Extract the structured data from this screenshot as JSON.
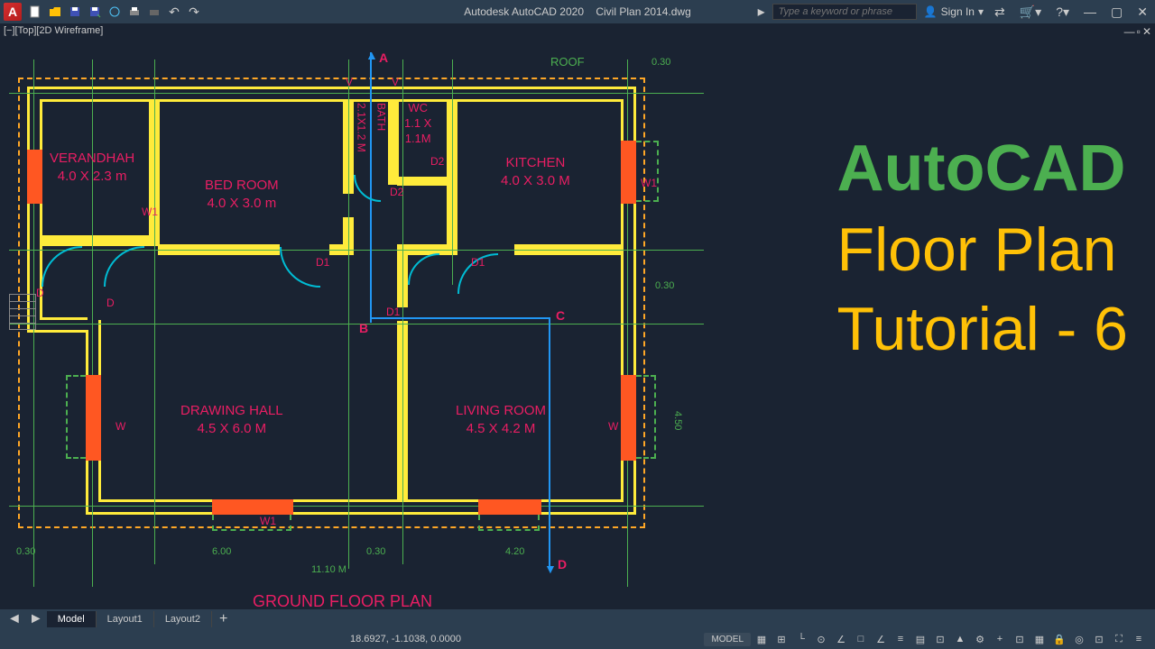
{
  "app": {
    "title": "Autodesk AutoCAD 2020",
    "file": "Civil Plan 2014.dwg",
    "search_placeholder": "Type a keyword or phrase",
    "signin": "Sign In",
    "viewport": "[−][Top][2D Wireframe]"
  },
  "overlay": {
    "line1": "AutoCAD",
    "line2": "Floor Plan",
    "line3": "Tutorial - 6"
  },
  "rooms": {
    "verandah": "VERANDHAH\n4.0 X 2.3 m",
    "bedroom": "BED ROOM\n4.0 X 3.0 m",
    "wc": "WC\n1.1 X\n1.1M",
    "bath": "2.1X1.2 M",
    "bath_label": "BATH",
    "kitchen": "KITCHEN\n4.0 X 3.0 M",
    "drawing": "DRAWING HALL\n4.5 X 6.0 M",
    "living": "LIVING ROOM\n4.5 X 4.2 M",
    "title": "GROUND FLOOR PLAN",
    "roof": "ROOF"
  },
  "labels": {
    "d": "D",
    "d1": "D1",
    "d2": "D2",
    "w": "W",
    "w1": "W1",
    "v": "V",
    "a": "A",
    "b": "B",
    "c": "C"
  },
  "dims": {
    "d030": "0.30",
    "d600": "6.00",
    "d420": "4.20",
    "d1110": "11.10 M",
    "d450": "4.50",
    "d030v": "0.30"
  },
  "tabs": {
    "model": "Model",
    "l1": "Layout1",
    "l2": "Layout2"
  },
  "status": {
    "coords": "18.6927, -1.1038, 0.0000",
    "model": "MODEL"
  }
}
